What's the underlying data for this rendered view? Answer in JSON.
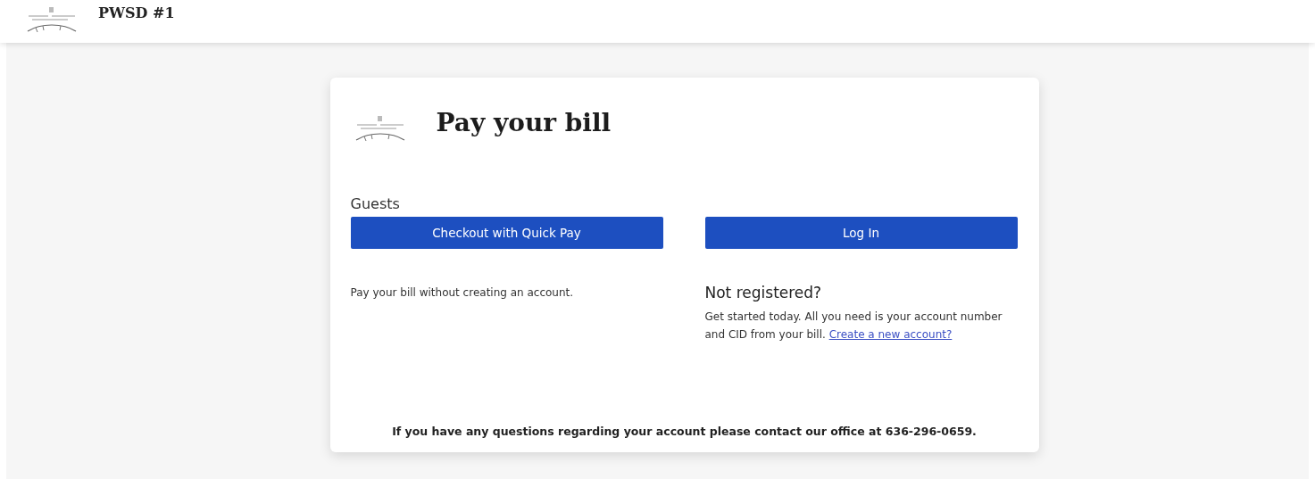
{
  "header": {
    "title": "PWSD #1"
  },
  "card": {
    "title": "Pay your bill",
    "guests": {
      "heading": "Guests",
      "button": "Checkout with Quick Pay",
      "text": "Pay your bill without creating an account."
    },
    "members": {
      "button": "Log In",
      "heading": "Not registered?",
      "text": "Get started today. All you need is your account number and CID from your bill.",
      "link": "Create a new account?"
    },
    "footer": "If you have any questions regarding your account please contact our office at 636-296-0659."
  }
}
